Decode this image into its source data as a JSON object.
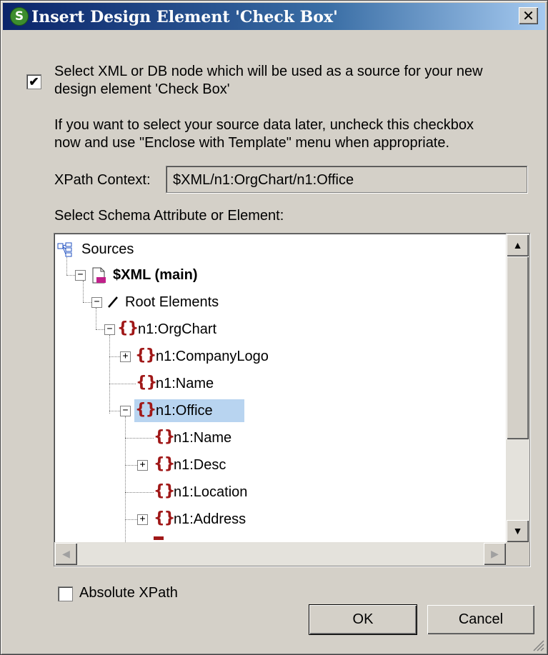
{
  "title": "Insert Design Element 'Check Box'",
  "app_icon_glyph": "S",
  "close_glyph": "✕",
  "source_checkbox": {
    "checked": true,
    "mark": "✔"
  },
  "source_text_line1": "Select XML or DB node which will be used as a source for your new",
  "source_text_line2": "design element 'Check Box'",
  "info_line1": "If you want to select your source data later, uncheck this checkbox",
  "info_line2": "now and use \"Enclose with Template\" menu when appropriate.",
  "xpath_context_label": "XPath Context:",
  "xpath_context_value": "$XML/n1:OrgChart/n1:Office",
  "tree_label": "Select Schema Attribute or Element:",
  "element_glyph": "{}",
  "tree": {
    "sources": "Sources",
    "xml_main": "$XML (main)",
    "root_elements": "Root Elements",
    "orgchart": "n1:OrgChart",
    "company_logo": "n1:CompanyLogo",
    "name": "n1:Name",
    "office": "n1:Office",
    "office_name": "n1:Name",
    "desc": "n1:Desc",
    "location": "n1:Location",
    "address": "n1:Address"
  },
  "absolute_xpath_label": "Absolute XPath",
  "absolute_xpath_checked": false,
  "ok_label": "OK",
  "cancel_label": "Cancel",
  "colors": {
    "selection": "#b8d4f0",
    "element_icon": "#a01818",
    "titlebar_start": "#0a246a"
  }
}
